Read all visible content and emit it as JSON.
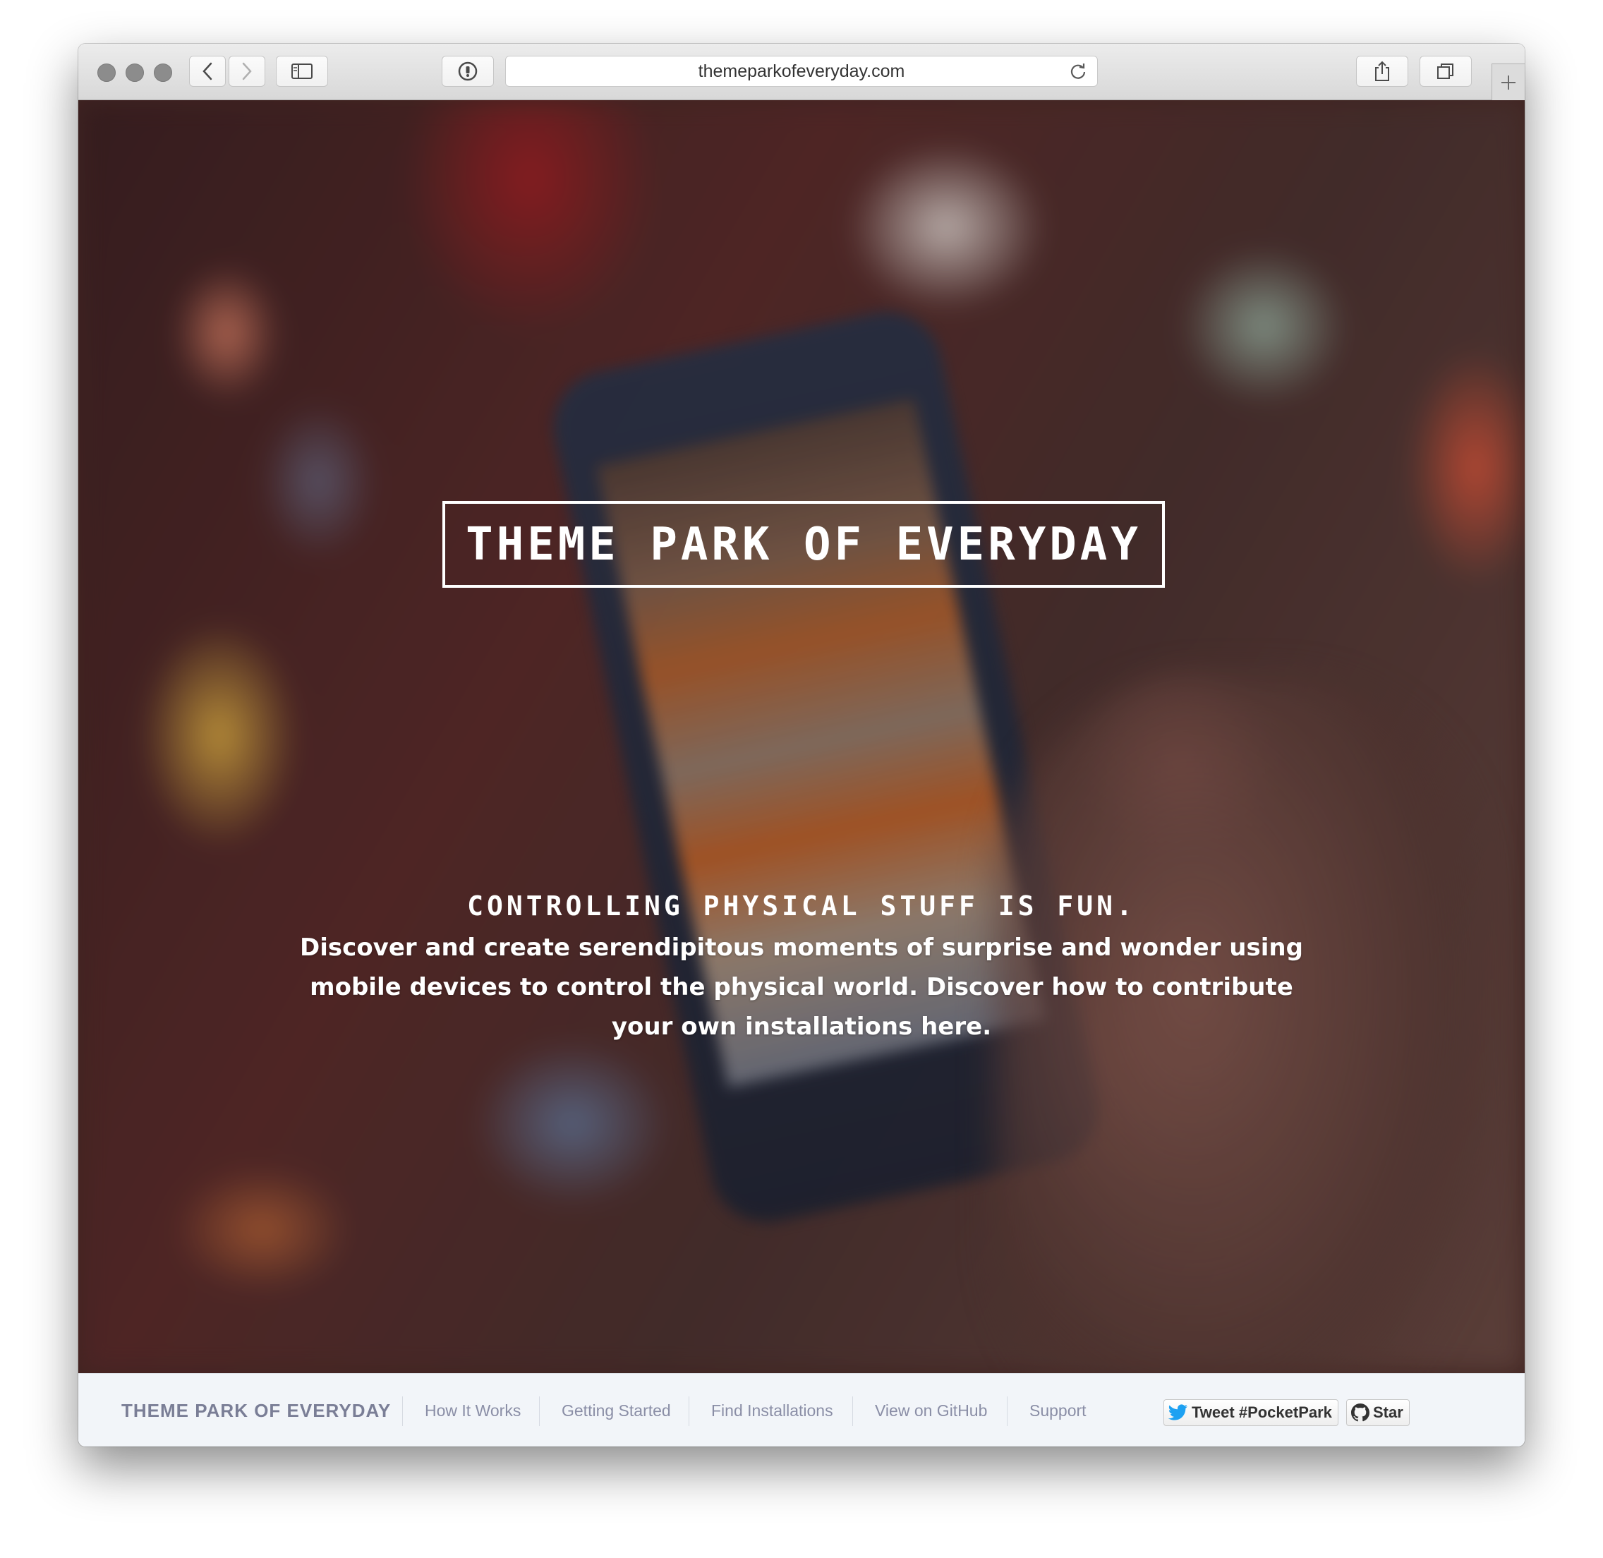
{
  "browser": {
    "url": "themeparkofeveryday.com"
  },
  "hero": {
    "title": "Theme Park of Everyday",
    "tagline": "Controlling physical stuff is fun.",
    "description": "Discover and create serendipitous moments of surprise and wonder using mobile devices to control the physical world. Discover how to contribute your own installations here."
  },
  "nav": {
    "brand": "THEME PARK OF EVERYDAY",
    "links": [
      "How It Works",
      "Getting Started",
      "Find Installations",
      "View on GitHub",
      "Support"
    ],
    "tweet_label": "Tweet #PocketPark",
    "star_label": "Star"
  },
  "colors": {
    "nav_background": "#f2f5f9",
    "nav_text": "#8a8ea6",
    "twitter_blue": "#1da1f2"
  },
  "icons": [
    "back-icon",
    "forward-icon",
    "sidebar-icon",
    "password-icon",
    "reload-icon",
    "share-icon",
    "tabs-icon",
    "new-tab-icon",
    "twitter-icon",
    "github-icon"
  ]
}
